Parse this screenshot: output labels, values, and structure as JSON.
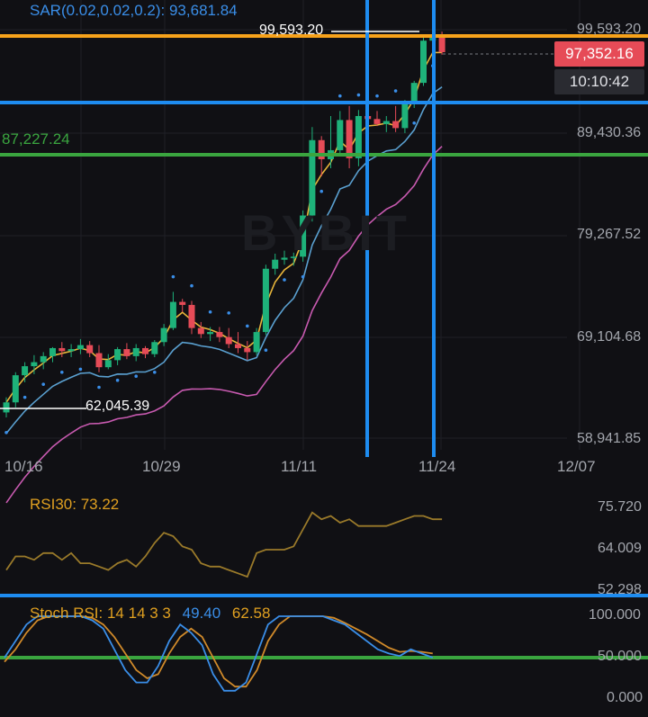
{
  "colors": {
    "background": "#101014",
    "up": "#1eb27a",
    "down": "#e64b57",
    "orange_line": "#f7a21b",
    "blue_line": "#1e8cf0",
    "green_line": "#3aa53f",
    "ema_yellow": "#e8b53a",
    "ema_blue": "#5aa0d0",
    "ema_pink": "#c85ab0",
    "sar": "#3a8ee8",
    "rsi": "#9a7a2a",
    "stoch_k": "#3a8ee8",
    "stoch_d": "#d08a2a"
  },
  "watermark": "BYBIT",
  "indicators": {
    "sar_label": "SAR(0.02,0.02,0.2): 93,681.84",
    "rsi_label": "RSI30: 73.22",
    "stoch_prefix": "Stoch RSI: 14 14 3 3",
    "stoch_k": "49.40",
    "stoch_d": "62.58"
  },
  "price": {
    "current": "97,352.16",
    "countdown": "10:10:42",
    "high_marker": "99,593.20",
    "low_marker": "62,045.39",
    "green_level": "87,227.24"
  },
  "price_axis": [
    "99,593.20",
    "89,430.36",
    "79,267.52",
    "69,104.68",
    "58,941.85"
  ],
  "rsi_axis": [
    "75.720",
    "64.009",
    "52.298"
  ],
  "stoch_axis": [
    "100.000",
    "50.000",
    "0.000"
  ],
  "time_axis": [
    "10/16",
    "10/29",
    "11/11",
    "11/24",
    "12/07"
  ],
  "chart_data": {
    "type": "candlestick",
    "y_range": [
      58941.85,
      99593.2
    ],
    "candles": [
      [
        61500,
        63000,
        61000,
        62500
      ],
      [
        62500,
        65500,
        62000,
        65200
      ],
      [
        65200,
        66500,
        64500,
        66100
      ],
      [
        66100,
        67200,
        65300,
        66500
      ],
      [
        66500,
        67500,
        65800,
        67100
      ],
      [
        67100,
        68000,
        66500,
        67900
      ],
      [
        67900,
        68500,
        67000,
        67600
      ],
      [
        67600,
        68300,
        67000,
        67800
      ],
      [
        67800,
        68800,
        67300,
        68200
      ],
      [
        68200,
        68600,
        67000,
        67400
      ],
      [
        67400,
        68200,
        65500,
        66000
      ],
      [
        66000,
        67300,
        65800,
        66700
      ],
      [
        66700,
        68000,
        66200,
        67800
      ],
      [
        67800,
        68400,
        66800,
        67100
      ],
      [
        67100,
        68300,
        66600,
        67900
      ],
      [
        67900,
        68100,
        66900,
        67300
      ],
      [
        67300,
        68700,
        67000,
        68500
      ],
      [
        68500,
        70300,
        68100,
        69900
      ],
      [
        69900,
        73500,
        69700,
        72500
      ],
      [
        72500,
        72800,
        71500,
        72200
      ],
      [
        72200,
        72600,
        69300,
        69900
      ],
      [
        69900,
        70500,
        68900,
        69300
      ],
      [
        69300,
        70000,
        68600,
        69500
      ],
      [
        69500,
        70000,
        68500,
        69000
      ],
      [
        69000,
        69900,
        67900,
        68300
      ],
      [
        68300,
        69500,
        67400,
        67900
      ],
      [
        67900,
        68600,
        66700,
        67500
      ],
      [
        67500,
        69900,
        67200,
        69500
      ],
      [
        69500,
        76200,
        69200,
        75800
      ],
      [
        75800,
        77300,
        75200,
        76700
      ],
      [
        76700,
        77600,
        76200,
        76900
      ],
      [
        76900,
        77400,
        76100,
        77000
      ],
      [
        77000,
        81600,
        76500,
        81100
      ],
      [
        81100,
        89900,
        80500,
        88600
      ],
      [
        88600,
        89000,
        85000,
        86700
      ],
      [
        86700,
        91000,
        85800,
        87600
      ],
      [
        87600,
        91500,
        87000,
        90600
      ],
      [
        90600,
        92000,
        85800,
        86800
      ],
      [
        86800,
        91600,
        86000,
        91000
      ],
      [
        91000,
        92300,
        89500,
        90700
      ],
      [
        90700,
        91500,
        90000,
        90200
      ],
      [
        90200,
        91000,
        89400,
        90500
      ],
      [
        90500,
        92000,
        89400,
        89800
      ],
      [
        89800,
        92600,
        89300,
        92300
      ],
      [
        92300,
        94500,
        91800,
        94300
      ],
      [
        94300,
        98800,
        94000,
        98500
      ],
      [
        98500,
        99593.2,
        97500,
        99000
      ],
      [
        99000,
        99400,
        97100,
        97352.16
      ]
    ]
  }
}
